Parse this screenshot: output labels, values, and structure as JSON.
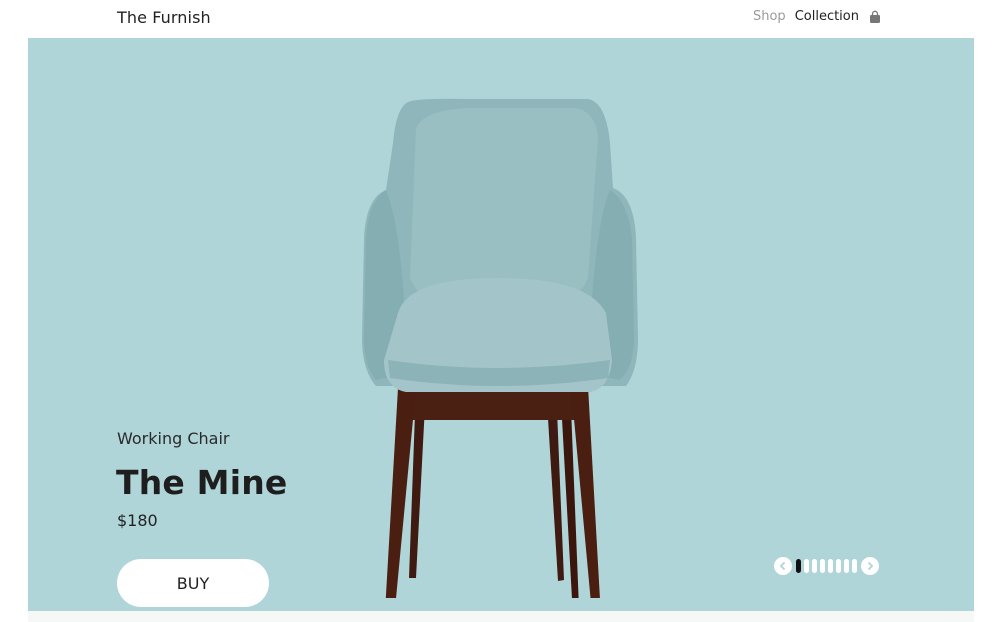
{
  "header": {
    "brand": "The Furnish",
    "nav": {
      "shop": "Shop",
      "collection": "Collection"
    },
    "cart_icon": "shopping-bag-icon"
  },
  "hero": {
    "background_color": "#b0d5d9",
    "product": {
      "type": "Working Chair",
      "name": "The Mine",
      "price": "$180"
    },
    "buy_label": "BUY",
    "carousel": {
      "prev_icon": "chevron-left-icon",
      "next_icon": "chevron-right-icon",
      "slide_count": 8,
      "active_index": 0
    }
  }
}
